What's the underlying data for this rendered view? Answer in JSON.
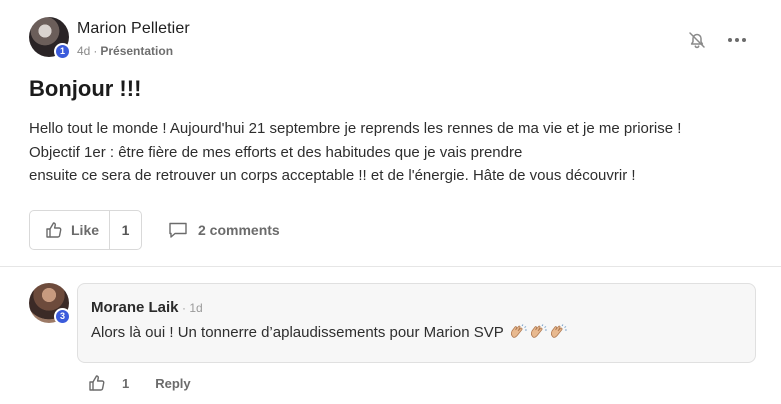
{
  "post": {
    "author": {
      "name": "Marion Pelletier",
      "level": "1"
    },
    "time": "4d",
    "separator": "·",
    "category": "Présentation",
    "title": "Bonjour !!!",
    "body": [
      "Hello tout le monde ! Aujourd'hui 21 septembre je reprends les rennes de ma vie et je me priorise !",
      "Objectif 1er : être fière de mes efforts et des habitudes que je vais prendre",
      "ensuite ce sera de retrouver un corps acceptable !! et de l'énergie. Hâte de vous découvrir !"
    ],
    "actions": {
      "like_label": "Like",
      "like_count": "1",
      "comments_label": "2 comments"
    }
  },
  "comment": {
    "author": {
      "name": "Morane Laik",
      "level": "3"
    },
    "separator": "·",
    "time": "1d",
    "text": "Alors là oui ! Un tonnerre d’aplaudissements pour Marion SVP",
    "emoji": [
      "clapping-hands",
      "clapping-hands",
      "clapping-hands"
    ],
    "like_count": "1",
    "reply_label": "Reply"
  },
  "icons": [
    "bell-off-icon",
    "more-options-icon",
    "thumbs-up-icon",
    "comment-icon"
  ],
  "colors": {
    "badge": "#3b5bdb",
    "bubble_bg": "#f7f7f7",
    "muted_text": "#6b6b6b"
  }
}
